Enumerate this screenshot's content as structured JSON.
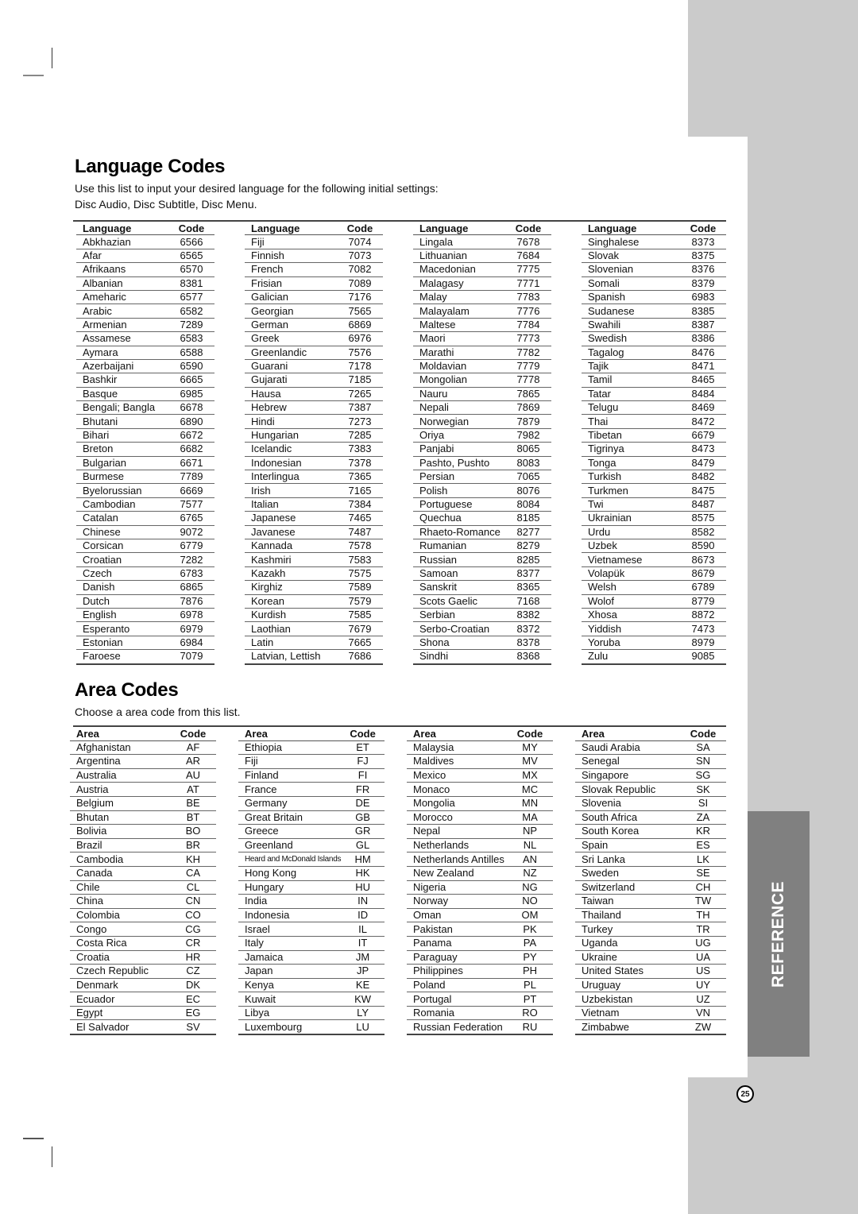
{
  "language_section": {
    "title": "Language Codes",
    "intro_line1": "Use this list to input your desired language for the following initial settings:",
    "intro_line2": "Disc Audio, Disc Subtitle, Disc Menu.",
    "headers": {
      "name": "Language",
      "code": "Code"
    },
    "columns": [
      [
        [
          "Abkhazian",
          "6566"
        ],
        [
          "Afar",
          "6565"
        ],
        [
          "Afrikaans",
          "6570"
        ],
        [
          "Albanian",
          "8381"
        ],
        [
          "Ameharic",
          "6577"
        ],
        [
          "Arabic",
          "6582"
        ],
        [
          "Armenian",
          "7289"
        ],
        [
          "Assamese",
          "6583"
        ],
        [
          "Aymara",
          "6588"
        ],
        [
          "Azerbaijani",
          "6590"
        ],
        [
          "Bashkir",
          "6665"
        ],
        [
          "Basque",
          "6985"
        ],
        [
          "Bengali; Bangla",
          "6678"
        ],
        [
          "Bhutani",
          "6890"
        ],
        [
          "Bihari",
          "6672"
        ],
        [
          "Breton",
          "6682"
        ],
        [
          "Bulgarian",
          "6671"
        ],
        [
          "Burmese",
          "7789"
        ],
        [
          "Byelorussian",
          "6669"
        ],
        [
          "Cambodian",
          "7577"
        ],
        [
          "Catalan",
          "6765"
        ],
        [
          "Chinese",
          "9072"
        ],
        [
          "Corsican",
          "6779"
        ],
        [
          "Croatian",
          "7282"
        ],
        [
          "Czech",
          "6783"
        ],
        [
          "Danish",
          "6865"
        ],
        [
          "Dutch",
          "7876"
        ],
        [
          "English",
          "6978"
        ],
        [
          "Esperanto",
          "6979"
        ],
        [
          "Estonian",
          "6984"
        ],
        [
          "Faroese",
          "7079"
        ]
      ],
      [
        [
          "Fiji",
          "7074"
        ],
        [
          "Finnish",
          "7073"
        ],
        [
          "French",
          "7082"
        ],
        [
          "Frisian",
          "7089"
        ],
        [
          "Galician",
          "7176"
        ],
        [
          "Georgian",
          "7565"
        ],
        [
          "German",
          "6869"
        ],
        [
          "Greek",
          "6976"
        ],
        [
          "Greenlandic",
          "7576"
        ],
        [
          "Guarani",
          "7178"
        ],
        [
          "Gujarati",
          "7185"
        ],
        [
          "Hausa",
          "7265"
        ],
        [
          "Hebrew",
          "7387"
        ],
        [
          "Hindi",
          "7273"
        ],
        [
          "Hungarian",
          "7285"
        ],
        [
          "Icelandic",
          "7383"
        ],
        [
          "Indonesian",
          "7378"
        ],
        [
          "Interlingua",
          "7365"
        ],
        [
          "Irish",
          "7165"
        ],
        [
          "Italian",
          "7384"
        ],
        [
          "Japanese",
          "7465"
        ],
        [
          "Javanese",
          "7487"
        ],
        [
          "Kannada",
          "7578"
        ],
        [
          "Kashmiri",
          "7583"
        ],
        [
          "Kazakh",
          "7575"
        ],
        [
          "Kirghiz",
          "7589"
        ],
        [
          "Korean",
          "7579"
        ],
        [
          "Kurdish",
          "7585"
        ],
        [
          "Laothian",
          "7679"
        ],
        [
          "Latin",
          "7665"
        ],
        [
          "Latvian, Lettish",
          "7686"
        ]
      ],
      [
        [
          "Lingala",
          "7678"
        ],
        [
          "Lithuanian",
          "7684"
        ],
        [
          "Macedonian",
          "7775"
        ],
        [
          "Malagasy",
          "7771"
        ],
        [
          "Malay",
          "7783"
        ],
        [
          "Malayalam",
          "7776"
        ],
        [
          "Maltese",
          "7784"
        ],
        [
          "Maori",
          "7773"
        ],
        [
          "Marathi",
          "7782"
        ],
        [
          "Moldavian",
          "7779"
        ],
        [
          "Mongolian",
          "7778"
        ],
        [
          "Nauru",
          "7865"
        ],
        [
          "Nepali",
          "7869"
        ],
        [
          "Norwegian",
          "7879"
        ],
        [
          "Oriya",
          "7982"
        ],
        [
          "Panjabi",
          "8065"
        ],
        [
          "Pashto, Pushto",
          "8083"
        ],
        [
          "Persian",
          "7065"
        ],
        [
          "Polish",
          "8076"
        ],
        [
          "Portuguese",
          "8084"
        ],
        [
          "Quechua",
          "8185"
        ],
        [
          "Rhaeto-Romance",
          "8277"
        ],
        [
          "Rumanian",
          "8279"
        ],
        [
          "Russian",
          "8285"
        ],
        [
          "Samoan",
          "8377"
        ],
        [
          "Sanskrit",
          "8365"
        ],
        [
          "Scots Gaelic",
          "7168"
        ],
        [
          "Serbian",
          "8382"
        ],
        [
          "Serbo-Croatian",
          "8372"
        ],
        [
          "Shona",
          "8378"
        ],
        [
          "Sindhi",
          "8368"
        ]
      ],
      [
        [
          "Singhalese",
          "8373"
        ],
        [
          "Slovak",
          "8375"
        ],
        [
          "Slovenian",
          "8376"
        ],
        [
          "Somali",
          "8379"
        ],
        [
          "Spanish",
          "6983"
        ],
        [
          "Sudanese",
          "8385"
        ],
        [
          "Swahili",
          "8387"
        ],
        [
          "Swedish",
          "8386"
        ],
        [
          "Tagalog",
          "8476"
        ],
        [
          "Tajik",
          "8471"
        ],
        [
          "Tamil",
          "8465"
        ],
        [
          "Tatar",
          "8484"
        ],
        [
          "Telugu",
          "8469"
        ],
        [
          "Thai",
          "8472"
        ],
        [
          "Tibetan",
          "6679"
        ],
        [
          "Tigrinya",
          "8473"
        ],
        [
          "Tonga",
          "8479"
        ],
        [
          "Turkish",
          "8482"
        ],
        [
          "Turkmen",
          "8475"
        ],
        [
          "Twi",
          "8487"
        ],
        [
          "Ukrainian",
          "8575"
        ],
        [
          "Urdu",
          "8582"
        ],
        [
          "Uzbek",
          "8590"
        ],
        [
          "Vietnamese",
          "8673"
        ],
        [
          "Volapük",
          "8679"
        ],
        [
          "Welsh",
          "6789"
        ],
        [
          "Wolof",
          "8779"
        ],
        [
          "Xhosa",
          "8872"
        ],
        [
          "Yiddish",
          "7473"
        ],
        [
          "Yoruba",
          "8979"
        ],
        [
          "Zulu",
          "9085"
        ]
      ]
    ]
  },
  "area_section": {
    "title": "Area Codes",
    "intro": "Choose a area code from this list.",
    "headers": {
      "name": "Area",
      "code": "Code"
    },
    "columns": [
      [
        [
          "Afghanistan",
          "AF"
        ],
        [
          "Argentina",
          "AR"
        ],
        [
          "Australia",
          "AU"
        ],
        [
          "Austria",
          "AT"
        ],
        [
          "Belgium",
          "BE"
        ],
        [
          "Bhutan",
          "BT"
        ],
        [
          "Bolivia",
          "BO"
        ],
        [
          "Brazil",
          "BR"
        ],
        [
          "Cambodia",
          "KH"
        ],
        [
          "Canada",
          "CA"
        ],
        [
          "Chile",
          "CL"
        ],
        [
          "China",
          "CN"
        ],
        [
          "Colombia",
          "CO"
        ],
        [
          "Congo",
          "CG"
        ],
        [
          "Costa Rica",
          "CR"
        ],
        [
          "Croatia",
          "HR"
        ],
        [
          "Czech Republic",
          "CZ"
        ],
        [
          "Denmark",
          "DK"
        ],
        [
          "Ecuador",
          "EC"
        ],
        [
          "Egypt",
          "EG"
        ],
        [
          "El Salvador",
          "SV"
        ]
      ],
      [
        [
          "Ethiopia",
          "ET"
        ],
        [
          "Fiji",
          "FJ"
        ],
        [
          "Finland",
          "FI"
        ],
        [
          "France",
          "FR"
        ],
        [
          "Germany",
          "DE"
        ],
        [
          "Great Britain",
          "GB"
        ],
        [
          "Greece",
          "GR"
        ],
        [
          "Greenland",
          "GL"
        ],
        [
          "Heard and McDonald Islands",
          "HM"
        ],
        [
          "Hong Kong",
          "HK"
        ],
        [
          "Hungary",
          "HU"
        ],
        [
          "India",
          "IN"
        ],
        [
          "Indonesia",
          "ID"
        ],
        [
          "Israel",
          "IL"
        ],
        [
          "Italy",
          "IT"
        ],
        [
          "Jamaica",
          "JM"
        ],
        [
          "Japan",
          "JP"
        ],
        [
          "Kenya",
          "KE"
        ],
        [
          "Kuwait",
          "KW"
        ],
        [
          "Libya",
          "LY"
        ],
        [
          "Luxembourg",
          "LU"
        ]
      ],
      [
        [
          "Malaysia",
          "MY"
        ],
        [
          "Maldives",
          "MV"
        ],
        [
          "Mexico",
          "MX"
        ],
        [
          "Monaco",
          "MC"
        ],
        [
          "Mongolia",
          "MN"
        ],
        [
          "Morocco",
          "MA"
        ],
        [
          "Nepal",
          "NP"
        ],
        [
          "Netherlands",
          "NL"
        ],
        [
          "Netherlands Antilles",
          "AN"
        ],
        [
          "New Zealand",
          "NZ"
        ],
        [
          "Nigeria",
          "NG"
        ],
        [
          "Norway",
          "NO"
        ],
        [
          "Oman",
          "OM"
        ],
        [
          "Pakistan",
          "PK"
        ],
        [
          "Panama",
          "PA"
        ],
        [
          "Paraguay",
          "PY"
        ],
        [
          "Philippines",
          "PH"
        ],
        [
          "Poland",
          "PL"
        ],
        [
          "Portugal",
          "PT"
        ],
        [
          "Romania",
          "RO"
        ],
        [
          "Russian Federation",
          "RU"
        ]
      ],
      [
        [
          "Saudi Arabia",
          "SA"
        ],
        [
          "Senegal",
          "SN"
        ],
        [
          "Singapore",
          "SG"
        ],
        [
          "Slovak Republic",
          "SK"
        ],
        [
          "Slovenia",
          "SI"
        ],
        [
          "South Africa",
          "ZA"
        ],
        [
          "South Korea",
          "KR"
        ],
        [
          "Spain",
          "ES"
        ],
        [
          "Sri Lanka",
          "LK"
        ],
        [
          "Sweden",
          "SE"
        ],
        [
          "Switzerland",
          "CH"
        ],
        [
          "Taiwan",
          "TW"
        ],
        [
          "Thailand",
          "TH"
        ],
        [
          "Turkey",
          "TR"
        ],
        [
          "Uganda",
          "UG"
        ],
        [
          "Ukraine",
          "UA"
        ],
        [
          "United States",
          "US"
        ],
        [
          "Uruguay",
          "UY"
        ],
        [
          "Uzbekistan",
          "UZ"
        ],
        [
          "Vietnam",
          "VN"
        ],
        [
          "Zimbabwe",
          "ZW"
        ]
      ]
    ]
  },
  "sidebar": {
    "tab_label": "REFERENCE",
    "tab_color": "#808080",
    "band_color": "#cbcbcb"
  },
  "page_number": "25"
}
